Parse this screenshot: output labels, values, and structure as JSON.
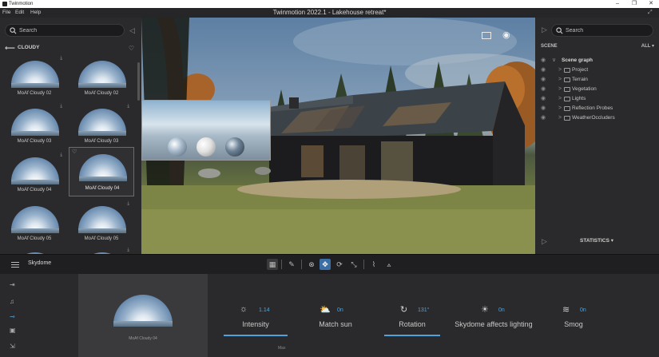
{
  "os": {
    "app_name": "Twinmotion",
    "minimize": "–",
    "maximize": "❐",
    "close": "✕"
  },
  "menu": {
    "items": [
      "File",
      "Edit",
      "Help"
    ],
    "doc_title": "Twinmotion 2022.1 - Lakehouse retreat*"
  },
  "library": {
    "search_placeholder": "Search",
    "category": "CLOUDY",
    "tiles": [
      {
        "label": "MoAf Cloudy 02"
      },
      {
        "label": "MoAf Cloudy 02"
      },
      {
        "label": "MoAf Cloudy 03"
      },
      {
        "label": "MoAf Cloudy 03"
      },
      {
        "label": "MoAf Cloudy 04"
      },
      {
        "label": "MoAf Cloudy 04"
      },
      {
        "label": "MoAf Cloudy 05"
      },
      {
        "label": "MoAf Cloudy 05"
      }
    ],
    "selected_index": 5
  },
  "scene": {
    "search_placeholder": "Search",
    "header": "SCENE",
    "filter": "ALL ▾",
    "root": "Scene graph",
    "items": [
      "Project",
      "Terrain",
      "Vegetation",
      "Lights",
      "Reflection Probes",
      "WeatherOccluders"
    ],
    "statistics": "STATISTICS ▾"
  },
  "toolbar": {
    "section_title": "Skydome"
  },
  "properties": {
    "asset_label": "MoAf Cloudy 04",
    "intensity": {
      "label": "Intensity",
      "value": "1.14",
      "sub": "Max"
    },
    "match_sun": {
      "label": "Match sun",
      "value": "0n"
    },
    "rotation": {
      "label": "Rotation",
      "value": "131°"
    },
    "affects_lighting": {
      "label": "Skydome affects lighting",
      "value": "0n"
    },
    "smog": {
      "label": "Smog",
      "value": "0n"
    }
  },
  "colors": {
    "accent": "#4ea3dc",
    "active_tool": "#3a6ea5",
    "panel": "#2a2a2c"
  }
}
